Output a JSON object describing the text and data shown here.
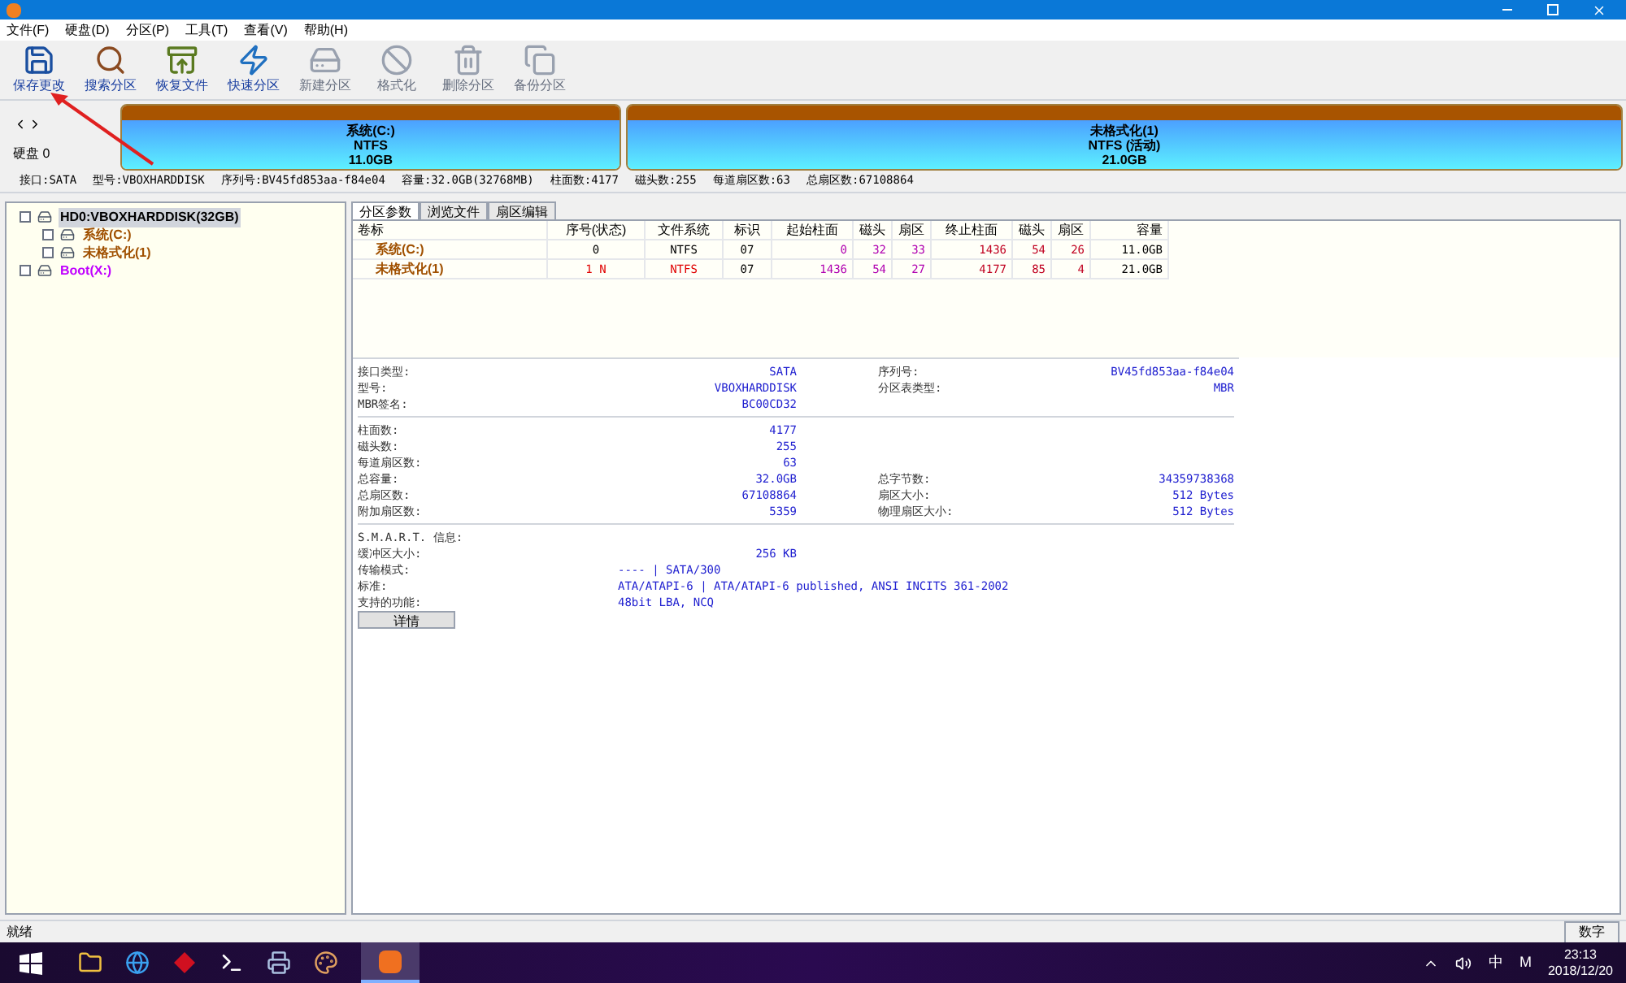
{
  "menu": [
    "文件(F)",
    "硬盘(D)",
    "分区(P)",
    "工具(T)",
    "查看(V)",
    "帮助(H)"
  ],
  "toolbar": [
    {
      "label": "保存更改",
      "disabled": false
    },
    {
      "label": "搜索分区",
      "disabled": false
    },
    {
      "label": "恢复文件",
      "disabled": false
    },
    {
      "label": "快速分区",
      "disabled": false
    },
    {
      "label": "新建分区",
      "disabled": true
    },
    {
      "label": "格式化",
      "disabled": true
    },
    {
      "label": "删除分区",
      "disabled": true
    },
    {
      "label": "备份分区",
      "disabled": true
    }
  ],
  "disk_map": {
    "disk_label": "硬盘 0",
    "partitions": [
      {
        "name": "系统(C:)",
        "fs": "NTFS",
        "size": "11.0GB"
      },
      {
        "name": "未格式化(1)",
        "fs": "NTFS (活动)",
        "size": "21.0GB"
      }
    ]
  },
  "disk_info": [
    "接口:SATA",
    "型号:VBOXHARDDISK",
    "序列号:BV45fd853aa-f84e04",
    "容量:32.0GB(32768MB)",
    "柱面数:4177",
    "磁头数:255",
    "每道扇区数:63",
    "总扇区数:67108864"
  ],
  "tree": [
    {
      "label": "HD0:VBOXHARDDISK(32GB)",
      "color": "#000000",
      "selected": true,
      "children": [
        {
          "label": "系统(C:)",
          "color": "#a05000",
          "selected": false
        },
        {
          "label": "未格式化(1)",
          "color": "#a05000",
          "selected": false
        }
      ]
    },
    {
      "label": "Boot(X:)",
      "color": "#c000ff",
      "selected": false
    }
  ],
  "tabs": [
    {
      "label": "分区参数",
      "selected": true
    },
    {
      "label": "浏览文件",
      "selected": false
    },
    {
      "label": "扇区编辑",
      "selected": false
    }
  ],
  "table": {
    "columns": [
      "卷标",
      "序号(状态)",
      "文件系统",
      "标识",
      "起始柱面",
      "磁头",
      "扇区",
      "终止柱面",
      "磁头",
      "扇区",
      "容量"
    ],
    "rows": [
      {
        "active": false,
        "cells": [
          "系统(C:)",
          "0",
          "NTFS",
          "07",
          "0",
          "32",
          "33",
          "1436",
          "54",
          "26",
          "11.0GB"
        ]
      },
      {
        "active": true,
        "cells": [
          "未格式化(1)",
          "1 N",
          "NTFS",
          "07",
          "1436",
          "54",
          "27",
          "4177",
          "85",
          "4",
          "21.0GB"
        ]
      }
    ]
  },
  "details": [
    [
      {
        "label": "接口类型:",
        "value": "SATA",
        "label2": "序列号:",
        "value2": "BV45fd853aa-f84e04"
      },
      {
        "label": "型号:",
        "value": "VBOXHARDDISK",
        "label2": "分区表类型:",
        "value2": "MBR"
      },
      {
        "label": "MBR签名:",
        "value": "BC00CD32"
      }
    ],
    [
      {
        "label": "柱面数:",
        "value": "4177"
      },
      {
        "label": "磁头数:",
        "value": "255"
      },
      {
        "label": "每道扇区数:",
        "value": "63"
      },
      {
        "label": "总容量:",
        "value": "32.0GB",
        "label2": "总字节数:",
        "value2": "34359738368"
      },
      {
        "label": "总扇区数:",
        "value": "67108864",
        "label2": "扇区大小:",
        "value2": "512 Bytes"
      },
      {
        "label": "附加扇区数:",
        "value": "5359",
        "label2": "物理扇区大小:",
        "value2": "512 Bytes"
      }
    ]
  ],
  "smart": {
    "title": "S.M.A.R.T. 信息:",
    "rows": [
      {
        "label": "缓冲区大小:",
        "value": "256 KB",
        "kind": "right"
      },
      {
        "label": "传输模式:",
        "value": "---- | SATA/300",
        "kind": "left"
      },
      {
        "label": "标准:",
        "value": "ATA/ATAPI-6 | ATA/ATAPI-6 published, ANSI INCITS 361-2002",
        "kind": "left"
      },
      {
        "label": "支持的功能:",
        "value": "48bit LBA, NCQ",
        "kind": "left"
      }
    ],
    "button": "详情"
  },
  "status_bar": {
    "left": "就绪",
    "right": "数字"
  },
  "taskbar": {
    "tray": [
      "中",
      "M"
    ],
    "time": "23:13",
    "date": "2018/12/20"
  }
}
